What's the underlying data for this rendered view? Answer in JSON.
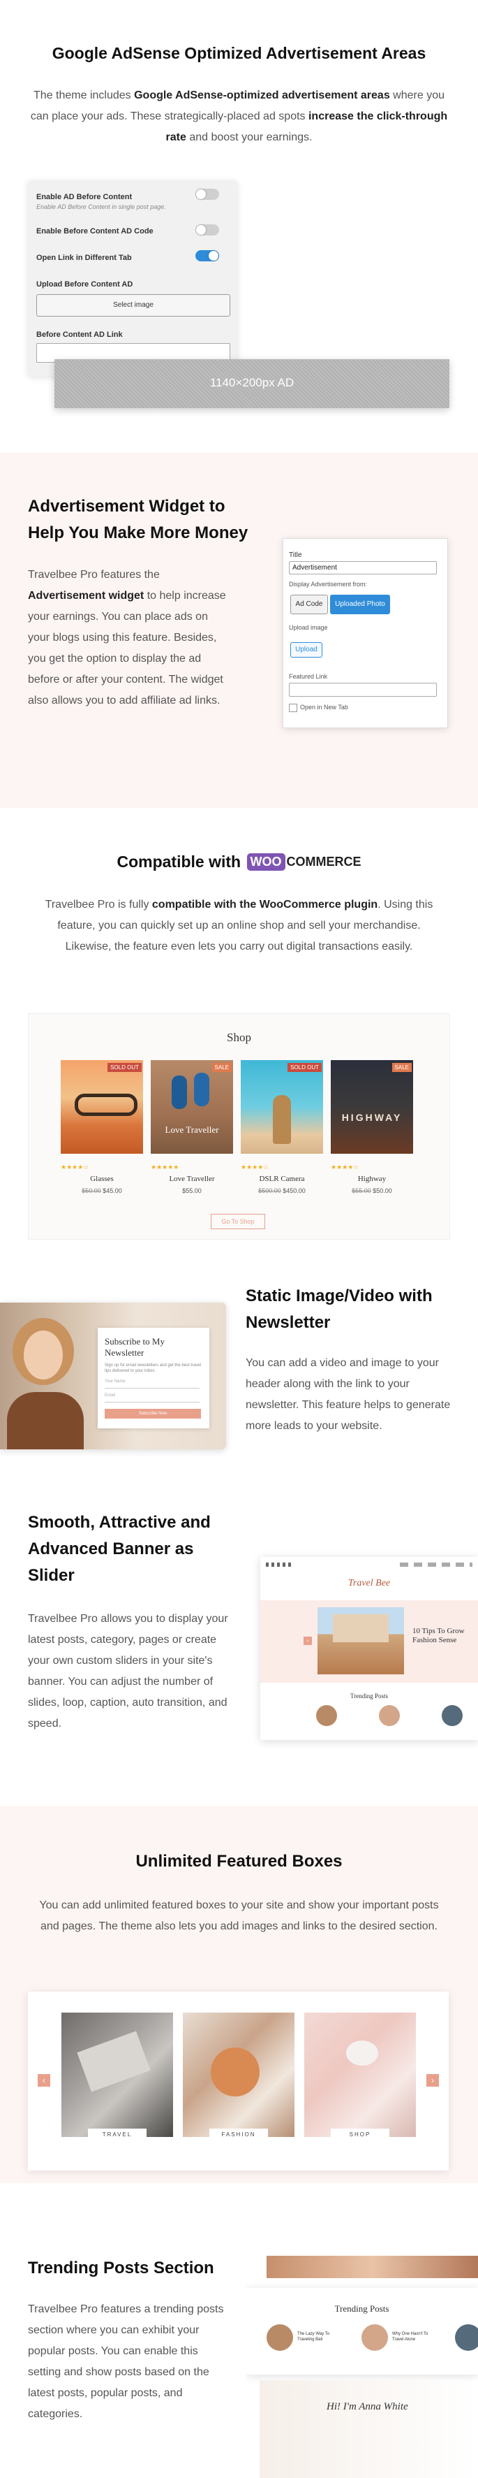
{
  "adsense": {
    "title": "Google AdSense Optimized Advertisement Areas",
    "desc_1": "The theme includes ",
    "desc_bold_1": "Google AdSense-optimized advertisement areas",
    "desc_2": " where you can place your ads. These strategically-placed ad spots ",
    "desc_bold_2": "increase the click-through rate",
    "desc_3": " and boost your earnings.",
    "panel": {
      "enable_before_label": "Enable AD Before Content",
      "enable_before_hint": "Enable AD Before Content in single post page.",
      "enable_before_code_label": "Enable Before Content AD Code",
      "open_link_label": "Open Link in Different Tab",
      "upload_label": "Upload Before Content AD",
      "select_image": "Select image",
      "link_label": "Before Content AD Link"
    },
    "ad_placeholder": "1140×200px AD"
  },
  "widget": {
    "title": "Advertisement Widget to Help You Make More Money",
    "desc_1": "Travelbee Pro features the ",
    "desc_bold": "Advertisement widget",
    "desc_2": " to help increase your earnings. You can place ads on your blogs using this feature. Besides, you get the option to display the ad before or after your content. The widget also allows you to add affiliate ad links.",
    "form": {
      "title_label": "Title",
      "title_value": "Advertisement",
      "display_from_label": "Display Advertisement from:",
      "ad_code_btn": "Ad Code",
      "upload_photo_btn": "Uploaded Photo",
      "upload_image_label": "Upload image",
      "upload_btn": "Upload",
      "featured_link_label": "Featured Link",
      "open_new_tab_label": "Open in New Tab"
    }
  },
  "woo": {
    "title_prefix": "Compatible with",
    "logo_woo": "WOO",
    "logo_commerce": "COMMERCE",
    "desc_1": "Travelbee Pro is fully ",
    "desc_bold": "compatible with the WooCommerce plugin",
    "desc_2": ". Using this feature, you can quickly set up an online shop and sell your merchandise. Likewise, the feature even lets you carry out digital transactions easily.",
    "shop_title": "Shop",
    "products": [
      {
        "name": "Glasses",
        "old_price": "$50.00",
        "price": "$45.00",
        "badge": "SOLD OUT",
        "stars": "★★★★☆"
      },
      {
        "name": "Love Traveller",
        "old_price": "",
        "price": "$55.00",
        "badge": "SALE",
        "stars": "★★★★★"
      },
      {
        "name": "DSLR Camera",
        "old_price": "$500.00",
        "price": "$450.00",
        "badge": "SOLD OUT",
        "stars": "★★★★☆"
      },
      {
        "name": "Highway",
        "old_price": "$55.00",
        "price": "$50.00",
        "badge": "SALE",
        "stars": "★★★★☆"
      }
    ],
    "product_image_text": {
      "love_traveller": "Love Traveller",
      "highway": "HIGHWAY"
    },
    "go_to_shop": "Go To Shop"
  },
  "newsletter": {
    "title": "Static Image/Video with Newsletter",
    "desc": "You can add a video and image to your header along with the link to your newsletter. This feature helps to generate more leads to your website.",
    "card_title": "Subscribe to My Newsletter",
    "card_text": "Sign up for email newsletters and get the best travel tips delivered to your inbox.",
    "name_placeholder": "Your Name",
    "email_placeholder": "Email",
    "button": "Subscribe Now"
  },
  "slider": {
    "title": "Smooth, Attractive and Advanced Banner as Slider",
    "desc": "Travelbee Pro allows you to display your latest posts, category, pages or create your own custom sliders in your site's banner. You can adjust the number of slides, loop, caption, auto transition, and speed.",
    "mock_logo": "Travel Bee",
    "slide_title": "10 Tips To Grow Fashion Sense",
    "trending_label": "Trending Posts"
  },
  "featured": {
    "title": "Unlimited Featured Boxes",
    "desc": "You can add unlimited featured boxes to your site and show your important posts and pages. The theme also lets you add images and links to the desired section.",
    "boxes": [
      "TRAVEL",
      "FASHION",
      "SHOP"
    ]
  },
  "trending": {
    "title": "Trending Posts Section",
    "desc": "Travelbee Pro features a trending posts section where you can exhibit your popular posts. You can enable this setting and show posts based on the latest posts, popular posts, and categories.",
    "mock_heading": "Trending Posts",
    "post_1_title": "The Lazy Way To Traveling Bali",
    "post_2_title": "Why One Hasn't To Travel Alone",
    "hi_text": "Hi! I'm Anna White"
  },
  "colors": {
    "accent": "#2f8cd8",
    "pink_bg": "#fdf5f3",
    "woo_purple": "#7f54b3",
    "shop_btn": "#e9a08b"
  }
}
